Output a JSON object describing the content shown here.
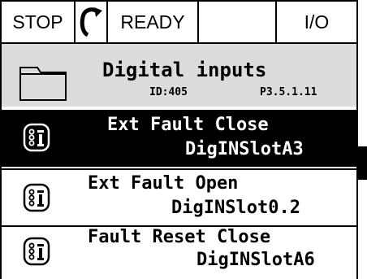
{
  "statusbar": {
    "stop": "STOP",
    "ready": "READY",
    "empty": "",
    "io": "I/O",
    "rotation_icon": "rotation-arrow-icon"
  },
  "header": {
    "icon": "folder-icon",
    "title": "Digital inputs",
    "id": "ID:405",
    "code": "P3.5.1.11"
  },
  "items": [
    {
      "name": "Ext Fault Close",
      "value": "DigINSlotA3",
      "icon": "io-parameter-icon",
      "selected": true
    },
    {
      "name": "Ext Fault Open",
      "value": "DigINSlot0.2",
      "icon": "io-parameter-icon",
      "selected": false
    },
    {
      "name": "Fault Reset Close",
      "value": "DigINSlotA6",
      "icon": "io-parameter-icon",
      "selected": false
    }
  ],
  "colors": {
    "header_bg": "#dcdcdc",
    "selected_bg": "#000000",
    "selected_fg": "#ffffff"
  }
}
